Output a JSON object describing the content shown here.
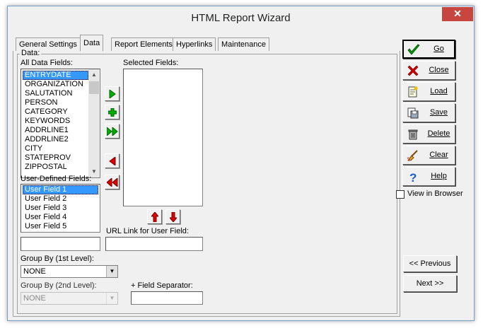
{
  "window": {
    "title": "HTML Report Wizard",
    "close_glyph": "✕"
  },
  "tabs": [
    "General Settings",
    "Data",
    "Report Elements",
    "Hyperlinks",
    "Maintenance"
  ],
  "data_group": {
    "legend": "Data:",
    "all_fields_label": "All Data Fields:",
    "all_fields": [
      "ENTRYDATE",
      "ORGANIZATION",
      "SALUTATION",
      "PERSON",
      "CATEGORY",
      "KEYWORDS",
      "ADDRLINE1",
      "ADDRLINE2",
      "CITY",
      "STATEPROV",
      "ZIPPOSTAL"
    ],
    "selected_fields_label": "Selected Fields:",
    "user_defined_label": "User-Defined Fields:",
    "user_fields": [
      "User Field 1",
      "User Field 2",
      "User Field 3",
      "User Field 4",
      "User Field 5"
    ],
    "url_link_label": "URL Link for User Field:",
    "group_by_1_label": "Group By (1st Level):",
    "group_by_1_value": "NONE",
    "group_by_2_label": "Group By (2nd Level):",
    "group_by_2_value": "NONE",
    "field_separator_label": "+ Field Separator:"
  },
  "buttons": {
    "go": "Go",
    "close": "Close",
    "load": "Load",
    "save": "Save",
    "delete": "Delete",
    "clear": "Clear",
    "help": "Help"
  },
  "view_in_browser": "View in Browser",
  "nav": {
    "previous": "<< Previous",
    "next": "Next >>"
  }
}
